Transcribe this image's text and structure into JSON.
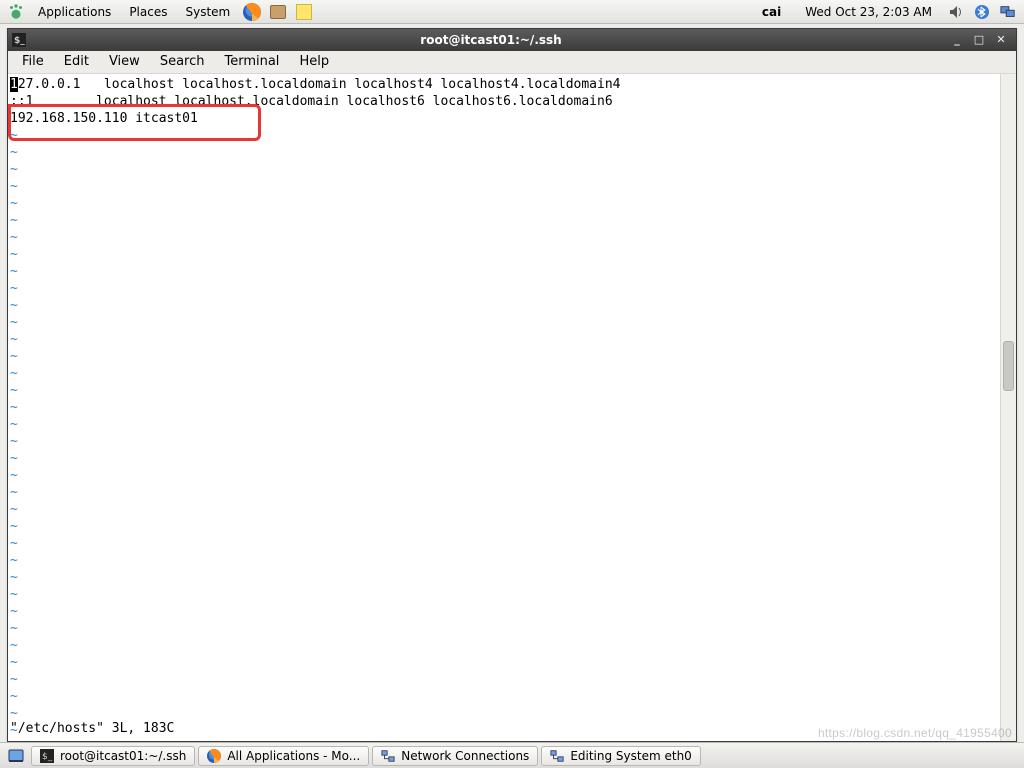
{
  "panel": {
    "menus": [
      "Applications",
      "Places",
      "System"
    ],
    "username": "cai",
    "datetime": "Wed Oct 23,  2:03 AM"
  },
  "window": {
    "title": "root@itcast01:~/.ssh",
    "menubar": [
      "File",
      "Edit",
      "View",
      "Search",
      "Terminal",
      "Help"
    ]
  },
  "terminal": {
    "cursor_char": "1",
    "lines": [
      "27.0.0.1   localhost localhost.localdomain localhost4 localhost4.localdomain4",
      "::1        localhost localhost.localdomain localhost6 localhost6.localdomain6",
      "192.168.150.110 itcast01"
    ],
    "tilde_count": 36,
    "status": "\"/etc/hosts\" 3L, 183C"
  },
  "taskbar": {
    "items": [
      {
        "label": "root@itcast01:~/.ssh",
        "icon": "terminal-icon"
      },
      {
        "label": "All Applications - Mo...",
        "icon": "firefox-icon"
      },
      {
        "label": "Network Connections",
        "icon": "network-icon"
      },
      {
        "label": "Editing System eth0",
        "icon": "network-icon"
      }
    ]
  },
  "watermark": "https://blog.csdn.net/qq_41955400"
}
